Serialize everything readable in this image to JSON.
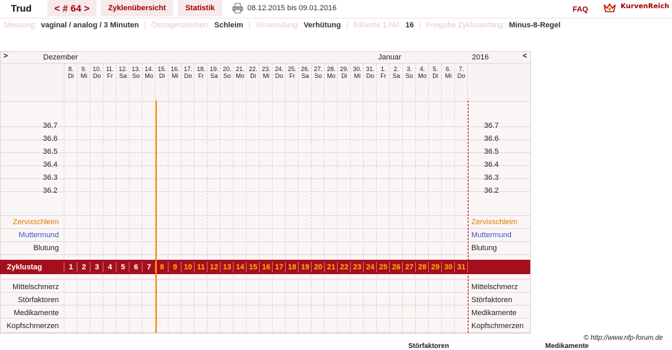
{
  "topbar": {
    "name": "Trud",
    "cycle": "< # 64 >",
    "overview": "Zyklenübersicht",
    "stats": "Statistik",
    "date_range": "08.12.2015 bis 09.01.2016",
    "faq": "FAQ",
    "brand": "KurvenReich"
  },
  "info": [
    {
      "label": "Messung:",
      "value": "vaginal / analog / 3 Minuten"
    },
    {
      "label": "Östrogenzeichen:",
      "value": "Schleim"
    },
    {
      "label": "Verwendung:",
      "value": "Verhütung"
    },
    {
      "label": "früheste 1.hM:",
      "value": "16"
    },
    {
      "label": "Freigabe Zyklusanfang:",
      "value": "Minus-8-Regel"
    }
  ],
  "chart": {
    "month_left": "Dezember",
    "month_right": "Januar",
    "year": "2016",
    "nav_left": ">",
    "nav_right": "<",
    "days": [
      {
        "d": "8.",
        "w": "Di"
      },
      {
        "d": "9.",
        "w": "Mi"
      },
      {
        "d": "10.",
        "w": "Do"
      },
      {
        "d": "11.",
        "w": "Fr"
      },
      {
        "d": "12.",
        "w": "Sa"
      },
      {
        "d": "13.",
        "w": "So"
      },
      {
        "d": "14.",
        "w": "Mo"
      },
      {
        "d": "15.",
        "w": "Di"
      },
      {
        "d": "16.",
        "w": "Mi"
      },
      {
        "d": "17.",
        "w": "Do"
      },
      {
        "d": "18.",
        "w": "Fr"
      },
      {
        "d": "19.",
        "w": "Sa"
      },
      {
        "d": "20.",
        "w": "So"
      },
      {
        "d": "21.",
        "w": "Mo"
      },
      {
        "d": "22.",
        "w": "Di"
      },
      {
        "d": "23.",
        "w": "Mi"
      },
      {
        "d": "24.",
        "w": "Do"
      },
      {
        "d": "25.",
        "w": "Fr"
      },
      {
        "d": "26.",
        "w": "Sa"
      },
      {
        "d": "27.",
        "w": "So"
      },
      {
        "d": "28.",
        "w": "Mo"
      },
      {
        "d": "29.",
        "w": "Di"
      },
      {
        "d": "30.",
        "w": "Mi"
      },
      {
        "d": "31.",
        "w": "Do"
      },
      {
        "d": "1.",
        "w": "Fr"
      },
      {
        "d": "2.",
        "w": "Sa"
      },
      {
        "d": "3.",
        "w": "So"
      },
      {
        "d": "4.",
        "w": "Mo"
      },
      {
        "d": "5.",
        "w": "Di"
      },
      {
        "d": "6.",
        "w": "Mi"
      },
      {
        "d": "7.",
        "w": "Do"
      }
    ],
    "temperatures": [
      "36.7",
      "36.6",
      "36.5",
      "36.4",
      "36.3",
      "36.2"
    ],
    "rows_top": [
      {
        "label": "Zervixschleim",
        "color": "#e07a00"
      },
      {
        "label": "Muttermund",
        "color": "#3a57c4"
      },
      {
        "label": "Blutung",
        "color": "#222222"
      }
    ],
    "cycle_label": "Zyklustag",
    "cycle_days": [
      "1",
      "2",
      "3",
      "4",
      "5",
      "6",
      "7",
      "8",
      "9",
      "10",
      "11",
      "12",
      "13",
      "14",
      "15",
      "16",
      "17",
      "18",
      "19",
      "20",
      "21",
      "22",
      "23",
      "24",
      "25",
      "26",
      "27",
      "28",
      "29",
      "30",
      "31"
    ],
    "cycle_day_white_count": 7,
    "rows_bottom": [
      "Mittelschmerz",
      "Störfaktoren",
      "Medikamente",
      "Kopfschmerzen"
    ],
    "colors": {
      "accent": "#a00000",
      "band": "#a50f1d",
      "today": "#ff8a00",
      "cycle_number": "#ffb400"
    }
  },
  "footer": {
    "copyright": "© http://www.nfp-forum.de",
    "cut_left": "Störfaktoren",
    "cut_right": "Medikamente"
  }
}
